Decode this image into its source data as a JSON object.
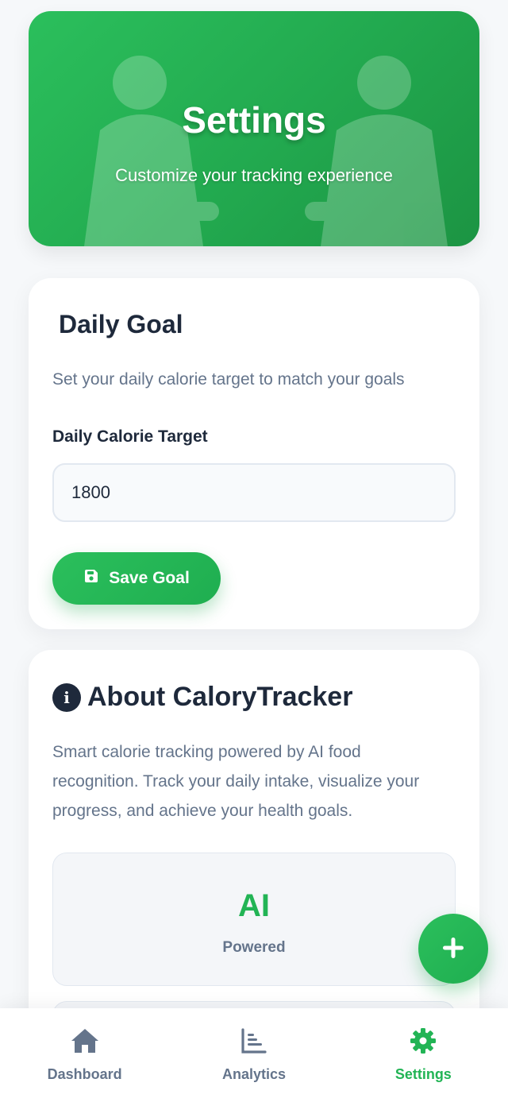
{
  "hero": {
    "title": "Settings",
    "subtitle": "Customize your tracking experience"
  },
  "daily_goal": {
    "title": "Daily Goal",
    "description": "Set your daily calorie target to match your goals",
    "field_label": "Daily Calorie Target",
    "calorie_value": "1800",
    "save_button": "Save Goal",
    "save_icon": "floppy-disk-icon"
  },
  "about": {
    "title": "About CaloryTracker",
    "title_icon": "info-circle-icon",
    "description": "Smart calorie tracking powered by AI food recognition. Track your daily intake, visualize your progress, and achieve your health goals.",
    "features": [
      {
        "value": "AI",
        "label": "Powered"
      }
    ]
  },
  "fab": {
    "icon": "plus-icon"
  },
  "bottom_nav": {
    "items": [
      {
        "label": "Dashboard",
        "icon": "home-icon",
        "active": false
      },
      {
        "label": "Analytics",
        "icon": "chart-icon",
        "active": false
      },
      {
        "label": "Settings",
        "icon": "gear-icon",
        "active": true
      }
    ]
  },
  "colors": {
    "accent": "#22b455",
    "text_dark": "#1e293b",
    "text_muted": "#64748b",
    "background": "#f6f8fa"
  }
}
